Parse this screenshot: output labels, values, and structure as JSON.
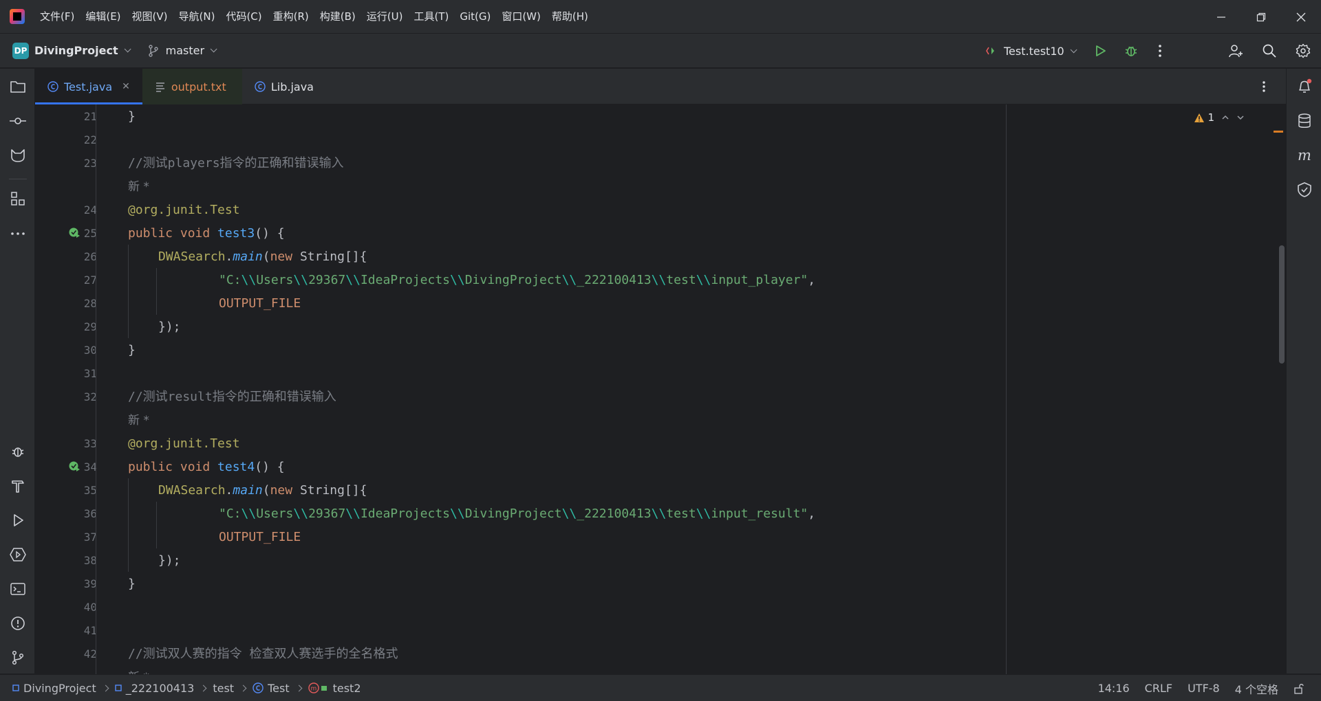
{
  "menu": [
    "文件(F)",
    "编辑(E)",
    "视图(V)",
    "导航(N)",
    "代码(C)",
    "重构(R)",
    "构建(B)",
    "运行(U)",
    "工具(T)",
    "Git(G)",
    "窗口(W)",
    "帮助(H)"
  ],
  "toolbar": {
    "project_badge": "DP",
    "project_name": "DivingProject",
    "branch": "master",
    "run_config": "Test.test10"
  },
  "tabs": [
    {
      "label": "Test.java",
      "active": true
    },
    {
      "label": "output.txt",
      "active": false
    },
    {
      "label": "Lib.java",
      "active": false
    }
  ],
  "inspection": {
    "warnings": "1"
  },
  "editor": {
    "line_numbers": [
      "21",
      "22",
      "23",
      "24",
      "25",
      "26",
      "27",
      "28",
      "29",
      "30",
      "31",
      "32",
      "33",
      "34",
      "35",
      "36",
      "37",
      "38",
      "39",
      "40",
      "41",
      "42"
    ],
    "hint_new": "新 *",
    "lines": {
      "l21": "}",
      "l23": "//测试players指令的正确和错误输入",
      "l24": "@org.junit.Test",
      "l25_kw": "public void ",
      "l25_fn": "test3",
      "l25_rest": "() {",
      "l26_cls": "DWASearch",
      "l26_fn": "main",
      "l26_kw": "new ",
      "l26_rest": "String[]{",
      "l27_path": [
        "\"C:",
        "\\\\",
        "Users",
        "\\\\",
        "29367",
        "\\\\",
        "IdeaProjects",
        "\\\\",
        "DivingProject",
        "\\\\",
        "_222100413",
        "\\\\",
        "test",
        "\\\\",
        "input_player\""
      ],
      "l28": "OUTPUT_FILE",
      "l29": "});",
      "l30": "}",
      "l32": "//测试result指令的正确和错误输入",
      "l33": "@org.junit.Test",
      "l34_fn": "test4",
      "l36_path": [
        "\"C:",
        "\\\\",
        "Users",
        "\\\\",
        "29367",
        "\\\\",
        "IdeaProjects",
        "\\\\",
        "DivingProject",
        "\\\\",
        "_222100413",
        "\\\\",
        "test",
        "\\\\",
        "input_result\""
      ],
      "l42": "//测试双人赛的指令 检查双人赛选手的全名格式"
    }
  },
  "statusbar": {
    "breadcrumb": [
      "DivingProject",
      "_222100413",
      "test",
      "Test",
      "test2"
    ],
    "position": "14:16",
    "line_sep": "CRLF",
    "encoding": "UTF-8",
    "indent": "4 个空格"
  },
  "colors": {
    "accent": "#3574f0",
    "background": "#1e1f22",
    "panel": "#2b2d30"
  }
}
